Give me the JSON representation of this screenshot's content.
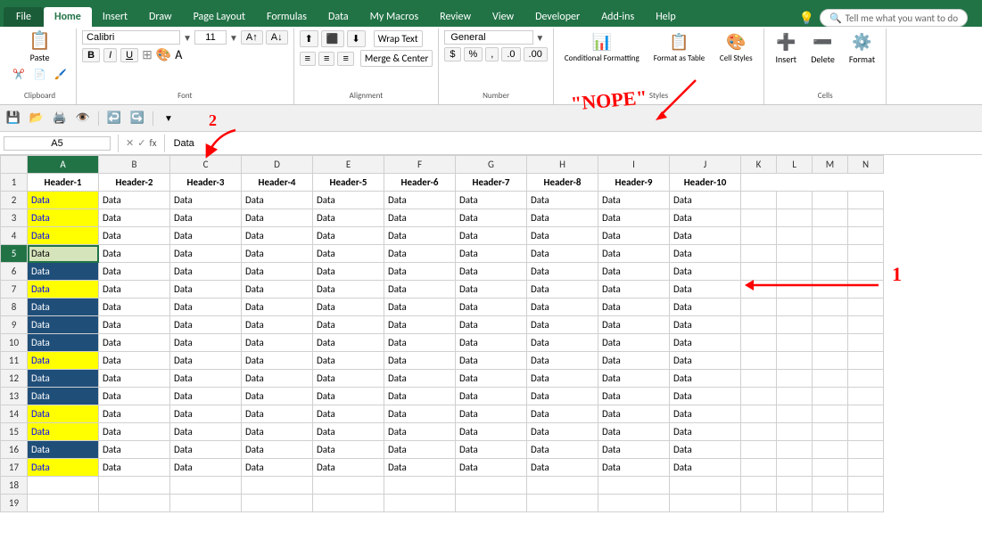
{
  "ribbon": {
    "tabs": [
      "File",
      "Home",
      "Insert",
      "Draw",
      "Page Layout",
      "Formulas",
      "Data",
      "My Macros",
      "Review",
      "View",
      "Developer",
      "Add-ins",
      "Help"
    ],
    "active_tab": "Home",
    "tell_me": "Tell me what you want to do",
    "groups": {
      "clipboard": "Clipboard",
      "font": "Font",
      "alignment": "Alignment",
      "number": "Number",
      "styles": "Styles",
      "cells": "Cells"
    },
    "font": {
      "name": "Calibri",
      "size": "11"
    },
    "number_format": "General",
    "wrap_text": "Wrap Text",
    "merge": "Merge & Center",
    "conditional_formatting": "Conditional Formatting",
    "format_as_table": "Format as Table",
    "cell_styles": "Cell Styles",
    "insert_btn": "Insert",
    "delete_btn": "Delete",
    "format_btn": "Format"
  },
  "formula_bar": {
    "cell_ref": "A5",
    "content": "Data"
  },
  "sheet": {
    "headers": [
      "Header-1",
      "Header-2",
      "Header-3",
      "Header-4",
      "Header-5",
      "Header-6",
      "Header-7",
      "Header-8",
      "Header-9",
      "Header-10"
    ],
    "col_letters": [
      "A",
      "B",
      "C",
      "D",
      "E",
      "F",
      "G",
      "H",
      "I",
      "J",
      "K",
      "L",
      "M",
      "N"
    ],
    "rows": [
      {
        "row": 2,
        "a_style": "bg-yellow",
        "data": [
          "Data",
          "Data",
          "Data",
          "Data",
          "Data",
          "Data",
          "Data",
          "Data",
          "Data",
          "Data"
        ]
      },
      {
        "row": 3,
        "a_style": "bg-yellow",
        "data": [
          "Data",
          "Data",
          "Data",
          "Data",
          "Data",
          "Data",
          "Data",
          "Data",
          "Data",
          "Data"
        ]
      },
      {
        "row": 4,
        "a_style": "bg-yellow",
        "data": [
          "Data",
          "Data",
          "Data",
          "Data",
          "Data",
          "Data",
          "Data",
          "Data",
          "Data",
          "Data"
        ]
      },
      {
        "row": 5,
        "a_style": "bg-green selected",
        "data": [
          "Data",
          "Data",
          "Data",
          "Data",
          "Data",
          "Data",
          "Data",
          "Data",
          "Data",
          "Data"
        ]
      },
      {
        "row": 6,
        "a_style": "bg-blue",
        "data": [
          "Data",
          "Data",
          "Data",
          "Data",
          "Data",
          "Data",
          "Data",
          "Data",
          "Data",
          "Data"
        ]
      },
      {
        "row": 7,
        "a_style": "bg-yellow",
        "data": [
          "Data",
          "Data",
          "Data",
          "Data",
          "Data",
          "Data",
          "Data",
          "Data",
          "Data",
          "Data"
        ]
      },
      {
        "row": 8,
        "a_style": "bg-blue",
        "data": [
          "Data",
          "Data",
          "Data",
          "Data",
          "Data",
          "Data",
          "Data",
          "Data",
          "Data",
          "Data"
        ]
      },
      {
        "row": 9,
        "a_style": "bg-blue",
        "data": [
          "Data",
          "Data",
          "Data",
          "Data",
          "Data",
          "Data",
          "Data",
          "Data",
          "Data",
          "Data"
        ]
      },
      {
        "row": 10,
        "a_style": "bg-blue",
        "data": [
          "Data",
          "Data",
          "Data",
          "Data",
          "Data",
          "Data",
          "Data",
          "Data",
          "Data",
          "Data"
        ]
      },
      {
        "row": 11,
        "a_style": "bg-yellow",
        "data": [
          "Data",
          "Data",
          "Data",
          "Data",
          "Data",
          "Data",
          "Data",
          "Data",
          "Data",
          "Data"
        ]
      },
      {
        "row": 12,
        "a_style": "bg-blue",
        "data": [
          "Data",
          "Data",
          "Data",
          "Data",
          "Data",
          "Data",
          "Data",
          "Data",
          "Data",
          "Data"
        ]
      },
      {
        "row": 13,
        "a_style": "bg-blue",
        "data": [
          "Data",
          "Data",
          "Data",
          "Data",
          "Data",
          "Data",
          "Data",
          "Data",
          "Data",
          "Data"
        ]
      },
      {
        "row": 14,
        "a_style": "bg-yellow",
        "data": [
          "Data",
          "Data",
          "Data",
          "Data",
          "Data",
          "Data",
          "Data",
          "Data",
          "Data",
          "Data"
        ]
      },
      {
        "row": 15,
        "a_style": "bg-yellow",
        "data": [
          "Data",
          "Data",
          "Data",
          "Data",
          "Data",
          "Data",
          "Data",
          "Data",
          "Data",
          "Data"
        ]
      },
      {
        "row": 16,
        "a_style": "bg-blue",
        "data": [
          "Data",
          "Data",
          "Data",
          "Data",
          "Data",
          "Data",
          "Data",
          "Data",
          "Data",
          "Data"
        ]
      },
      {
        "row": 17,
        "a_style": "bg-yellow",
        "data": [
          "Data",
          "Data",
          "Data",
          "Data",
          "Data",
          "Data",
          "Data",
          "Data",
          "Data",
          "Data"
        ]
      },
      {
        "row": 18,
        "a_style": "",
        "data": [
          "",
          "",
          "",
          "",
          "",
          "",
          "",
          "",
          "",
          ""
        ]
      },
      {
        "row": 19,
        "a_style": "",
        "data": [
          "",
          "",
          "",
          "",
          "",
          "",
          "",
          "",
          "",
          ""
        ]
      }
    ]
  },
  "annotations": {
    "nope": "\"NOPE\"",
    "arrow1": "1",
    "arrow2_top": "2",
    "arrow2_bottom": "2"
  }
}
